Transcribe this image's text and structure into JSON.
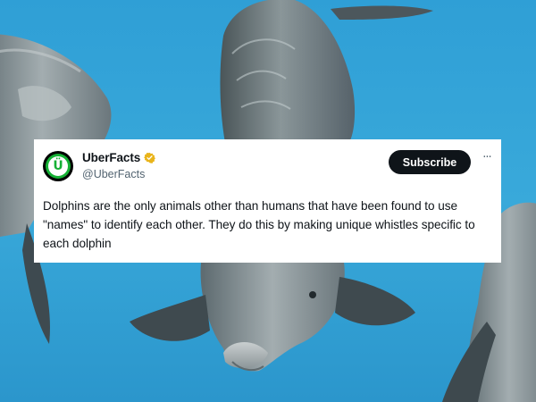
{
  "tweet": {
    "display_name": "UberFacts",
    "handle": "@UberFacts",
    "subscribe_label": "Subscribe",
    "more_label": "···",
    "text": "Dolphins are the only animals other than humans that have been found to use \"names\" to identify each other. They do this by making unique whistles specific to each dolphin",
    "avatar_letter": "Ü"
  },
  "colors": {
    "water": "#3aa6d8",
    "brand_green": "#16b035",
    "verified_gold": "#e9b41b",
    "button_dark": "#0f1419"
  }
}
